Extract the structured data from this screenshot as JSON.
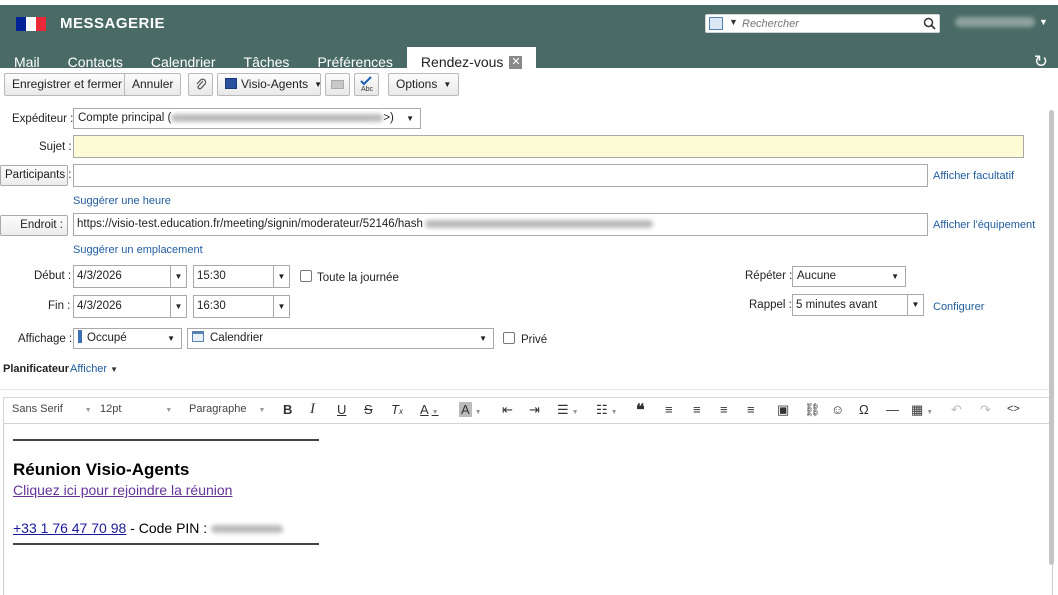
{
  "header": {
    "brand": "MESSAGERIE",
    "flag_colors": [
      "#002395",
      "#ffffff",
      "#ed2939"
    ],
    "search_placeholder": "Rechercher",
    "accent": "#4a6b65"
  },
  "tabs": [
    {
      "label": "Mail"
    },
    {
      "label": "Contacts"
    },
    {
      "label": "Calendrier"
    },
    {
      "label": "Tâches"
    },
    {
      "label": "Préférences"
    },
    {
      "label": "Rendez-vous",
      "active": true,
      "close": "✕"
    }
  ],
  "toolbar": {
    "save_close": "Enregistrer et fermer",
    "cancel": "Annuler",
    "visio": "Visio-Agents",
    "options": "Options"
  },
  "form": {
    "sender_label": "Expéditeur :",
    "sender_value_prefix": "Compte principal (",
    "sender_value_suffix": ">)",
    "subject_label": "Sujet :",
    "subject_value": "",
    "participants_label": "Participants :",
    "show_optional": "Afficher facultatif",
    "suggest_time": "Suggérer une heure",
    "location_label": "Endroit :",
    "location_value": "https://visio-test.education.fr/meeting/signin/moderateur/52146/hash",
    "show_equipment": "Afficher l'équipement",
    "suggest_location": "Suggérer un emplacement",
    "start_label": "Début :",
    "start_date": "4/3/2026",
    "start_time": "15:30",
    "all_day": "Toute la journée",
    "end_label": "Fin :",
    "end_date": "4/3/2026",
    "end_time": "16:30",
    "repeat_label": "Répéter :",
    "repeat_value": "Aucune",
    "reminder_label": "Rappel :",
    "reminder_value": "5 minutes avant",
    "configure": "Configurer",
    "display_label": "Affichage :",
    "display_value": "Occupé",
    "calendar_value": "Calendrier",
    "private": "Privé",
    "planner_label": "Planificateur",
    "planner_show": "Afficher"
  },
  "editor": {
    "font": "Sans Serif",
    "size": "12pt",
    "block": "Paragraphe",
    "heading": "Réunion Visio-Agents",
    "join_link": "Cliquez ici pour rejoindre la réunion",
    "phone": "+33 1 76 47 70 98",
    "pin_label": " - Code PIN : "
  }
}
